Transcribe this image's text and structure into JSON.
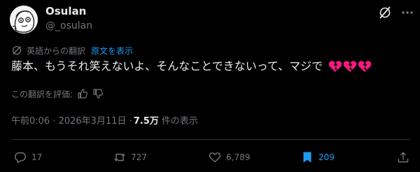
{
  "author": {
    "display_name": "Osulan",
    "handle": "@_osulan"
  },
  "translation": {
    "source_label": "英語からの翻訳",
    "show_original_label": "原文を表示",
    "rate_label": "この翻訳を評価:"
  },
  "tweet": {
    "text": "藤本、もうそれ笑えないよ、そんなことできないって、マジで",
    "emoji": [
      "broken-heart",
      "broken-heart",
      "broken-heart"
    ]
  },
  "meta": {
    "timestamp": "午前0:06 · 2026年3月11日 ·",
    "views": "7.5万",
    "views_suffix": "件の表示"
  },
  "actions": {
    "reply_count": "17",
    "repost_count": "727",
    "like_count": "6,789",
    "bookmark_count": "209"
  },
  "colors": {
    "background": "#000000",
    "text": "#e7e9ea",
    "muted": "#71767b",
    "accent": "#1d9bf0",
    "heart": "#f91880"
  },
  "icons": [
    "avatar-face",
    "grok-icon",
    "more-icon",
    "translate-icon",
    "thumbs-up-icon",
    "thumbs-down-icon",
    "reply-icon",
    "repost-icon",
    "like-icon",
    "bookmark-icon",
    "share-icon"
  ]
}
